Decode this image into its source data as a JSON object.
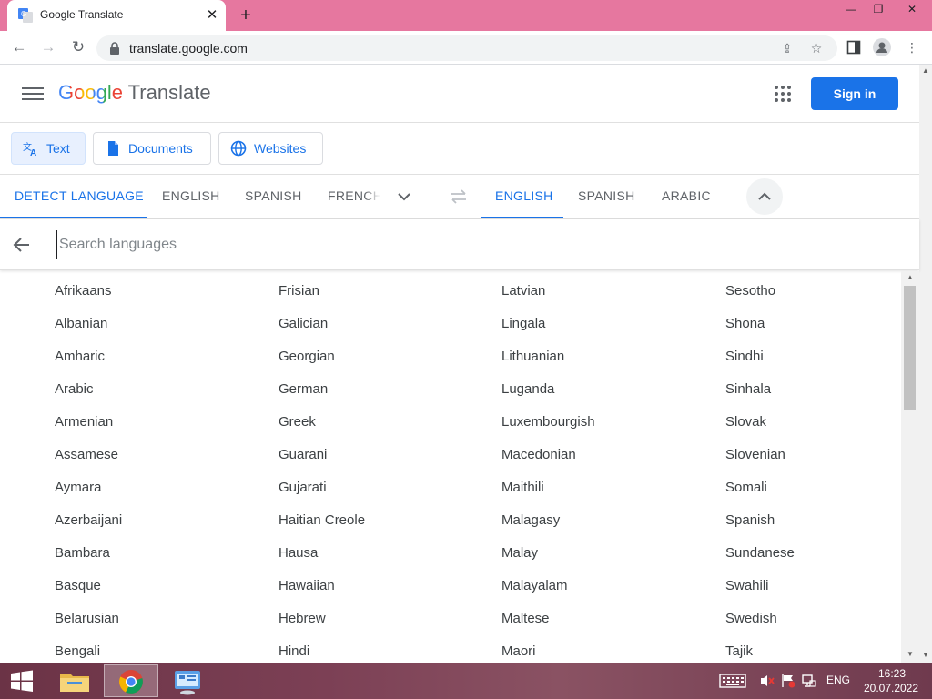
{
  "browser": {
    "tab_title": "Google Translate",
    "url": "translate.google.com",
    "tabstrip_color": "#e6779f"
  },
  "header": {
    "brand_google": "Google",
    "brand_product": "Translate",
    "signin_label": "Sign in",
    "accent": "#1a73e8"
  },
  "modes": [
    {
      "label": "Text",
      "icon": "translate-icon",
      "active": true
    },
    {
      "label": "Documents",
      "icon": "document-icon",
      "active": false
    },
    {
      "label": "Websites",
      "icon": "globe-icon",
      "active": false
    }
  ],
  "source_langs": [
    "DETECT LANGUAGE",
    "ENGLISH",
    "SPANISH",
    "FRENCH"
  ],
  "target_langs": [
    "ENGLISH",
    "SPANISH",
    "ARABIC"
  ],
  "search": {
    "placeholder": "Search languages"
  },
  "languages": [
    [
      "Afrikaans",
      "Albanian",
      "Amharic",
      "Arabic",
      "Armenian",
      "Assamese",
      "Aymara",
      "Azerbaijani",
      "Bambara",
      "Basque",
      "Belarusian",
      "Bengali"
    ],
    [
      "Frisian",
      "Galician",
      "Georgian",
      "German",
      "Greek",
      "Guarani",
      "Gujarati",
      "Haitian Creole",
      "Hausa",
      "Hawaiian",
      "Hebrew",
      "Hindi"
    ],
    [
      "Latvian",
      "Lingala",
      "Lithuanian",
      "Luganda",
      "Luxembourgish",
      "Macedonian",
      "Maithili",
      "Malagasy",
      "Malay",
      "Malayalam",
      "Maltese",
      "Maori"
    ],
    [
      "Sesotho",
      "Shona",
      "Sindhi",
      "Sinhala",
      "Slovak",
      "Slovenian",
      "Somali",
      "Spanish",
      "Sundanese",
      "Swahili",
      "Swedish",
      "Tajik"
    ]
  ],
  "taskbar": {
    "input_lang": "ENG",
    "time": "16:23",
    "date": "20.07.2022"
  }
}
